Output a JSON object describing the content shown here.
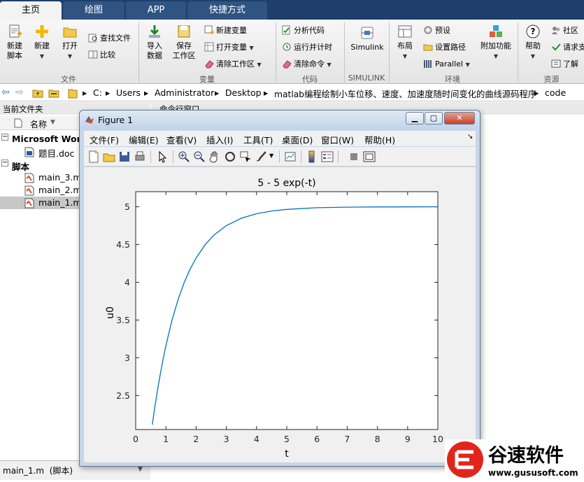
{
  "tabs": [
    {
      "label": "主页",
      "active": true
    },
    {
      "label": "绘图",
      "active": false
    },
    {
      "label": "APP",
      "active": false
    },
    {
      "label": "快捷方式",
      "active": false
    }
  ],
  "ribbon": {
    "file": {
      "new_script": "新建\n脚本",
      "new": "新建",
      "open": "打开",
      "find_files": "查找文件",
      "compare": "比较",
      "group": "文件"
    },
    "variable": {
      "import_data": "导入\n数据",
      "save_workspace": "保存\n工作区",
      "new_variable": "新建变量",
      "open_variable": "打开变量",
      "clear_workspace": "清除工作区",
      "group": "变量"
    },
    "code": {
      "analyze_code": "分析代码",
      "run_and_time": "运行并计时",
      "clear_commands": "清除命令",
      "group": "代码"
    },
    "simulink": {
      "label": "Simulink",
      "group": "SIMULINK"
    },
    "environment": {
      "layout": "布局",
      "preferences": "预设",
      "set_path": "设置路径",
      "parallel": "Parallel",
      "addons": "附加功能",
      "group": "环境"
    },
    "resources": {
      "help": "帮助",
      "community": "社区",
      "request_support": "请求支",
      "learn": "了解",
      "group": "资源"
    }
  },
  "address": {
    "crumbs": [
      "C:",
      "Users",
      "Administrator",
      "Desktop",
      "matlab编程绘制小车位移、速度、加速度随时间变化的曲线源码程序",
      "code"
    ]
  },
  "left_panel": {
    "title": "当前文件夹",
    "column_name": "名称",
    "groups": [
      {
        "label": "Microsoft Word",
        "items": [
          "题目.doc"
        ]
      },
      {
        "label": "脚本",
        "items": [
          "main_3.m",
          "main_2.m",
          "main_1.m"
        ]
      }
    ],
    "selected": "main_1.m",
    "details": "main_1.m  (脚本)"
  },
  "command_window": {
    "title": "命令行窗口"
  },
  "figure": {
    "title": "Figure 1",
    "menu": [
      "文件(F)",
      "编辑(E)",
      "查看(V)",
      "插入(I)",
      "工具(T)",
      "桌面(D)",
      "窗口(W)",
      "帮助(H)"
    ]
  },
  "chart_data": {
    "type": "line",
    "title": "5 - 5 exp(-t)",
    "xlabel": "t",
    "ylabel": "u0",
    "xlim": [
      0,
      10
    ],
    "ylim": [
      2.05,
      5.2
    ],
    "xticks": [
      0,
      1,
      2,
      3,
      4,
      5,
      6,
      7,
      8,
      9,
      10
    ],
    "yticks": [
      2.5,
      3,
      3.5,
      4,
      4.5,
      5
    ],
    "series": [
      {
        "expr": "5 - 5*exp(-t)",
        "x": [
          0.55,
          0.6,
          0.7,
          0.8,
          0.9,
          1.0,
          1.2,
          1.4,
          1.6,
          1.8,
          2.0,
          2.3,
          2.6,
          3.0,
          3.5,
          4.0,
          4.5,
          5.0,
          6.0,
          7.0,
          8.0,
          9.0,
          10.0
        ],
        "y": [
          2.115,
          2.256,
          2.517,
          2.753,
          2.967,
          3.161,
          3.494,
          3.767,
          3.991,
          4.174,
          4.323,
          4.499,
          4.629,
          4.751,
          4.849,
          4.908,
          4.944,
          4.966,
          4.988,
          4.995,
          4.998,
          4.999,
          5.0
        ],
        "color": "#0072bd"
      }
    ],
    "grid": false
  },
  "watermark": {
    "brand": "谷速软件",
    "url": "www.gususoft.com"
  }
}
